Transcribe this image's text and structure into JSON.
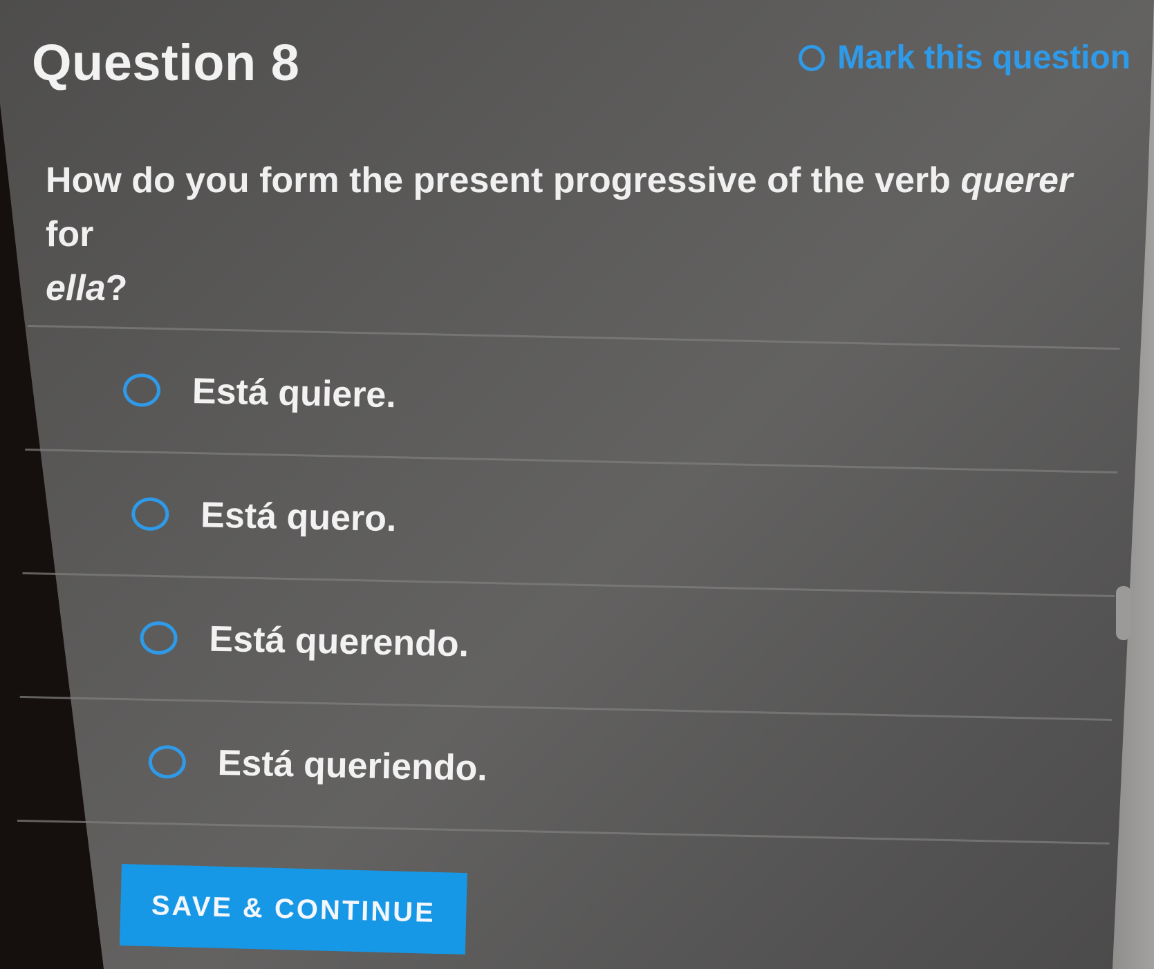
{
  "header": {
    "title": "Question 8",
    "mark_label": "Mark this question"
  },
  "question": {
    "text_before": "How do you form the present progressive of the verb ",
    "verb": "querer",
    "text_middle": " for ",
    "subject": "ella",
    "text_end": "?"
  },
  "choices": [
    {
      "label": "Está quiere."
    },
    {
      "label": "Está quero."
    },
    {
      "label": "Está querendo."
    },
    {
      "label": "Está queriendo."
    }
  ],
  "actions": {
    "save_label": "SAVE & CONTINUE"
  },
  "colors": {
    "accent": "#2f9ae8",
    "button": "#1798e6",
    "text": "#f2f2f2"
  }
}
